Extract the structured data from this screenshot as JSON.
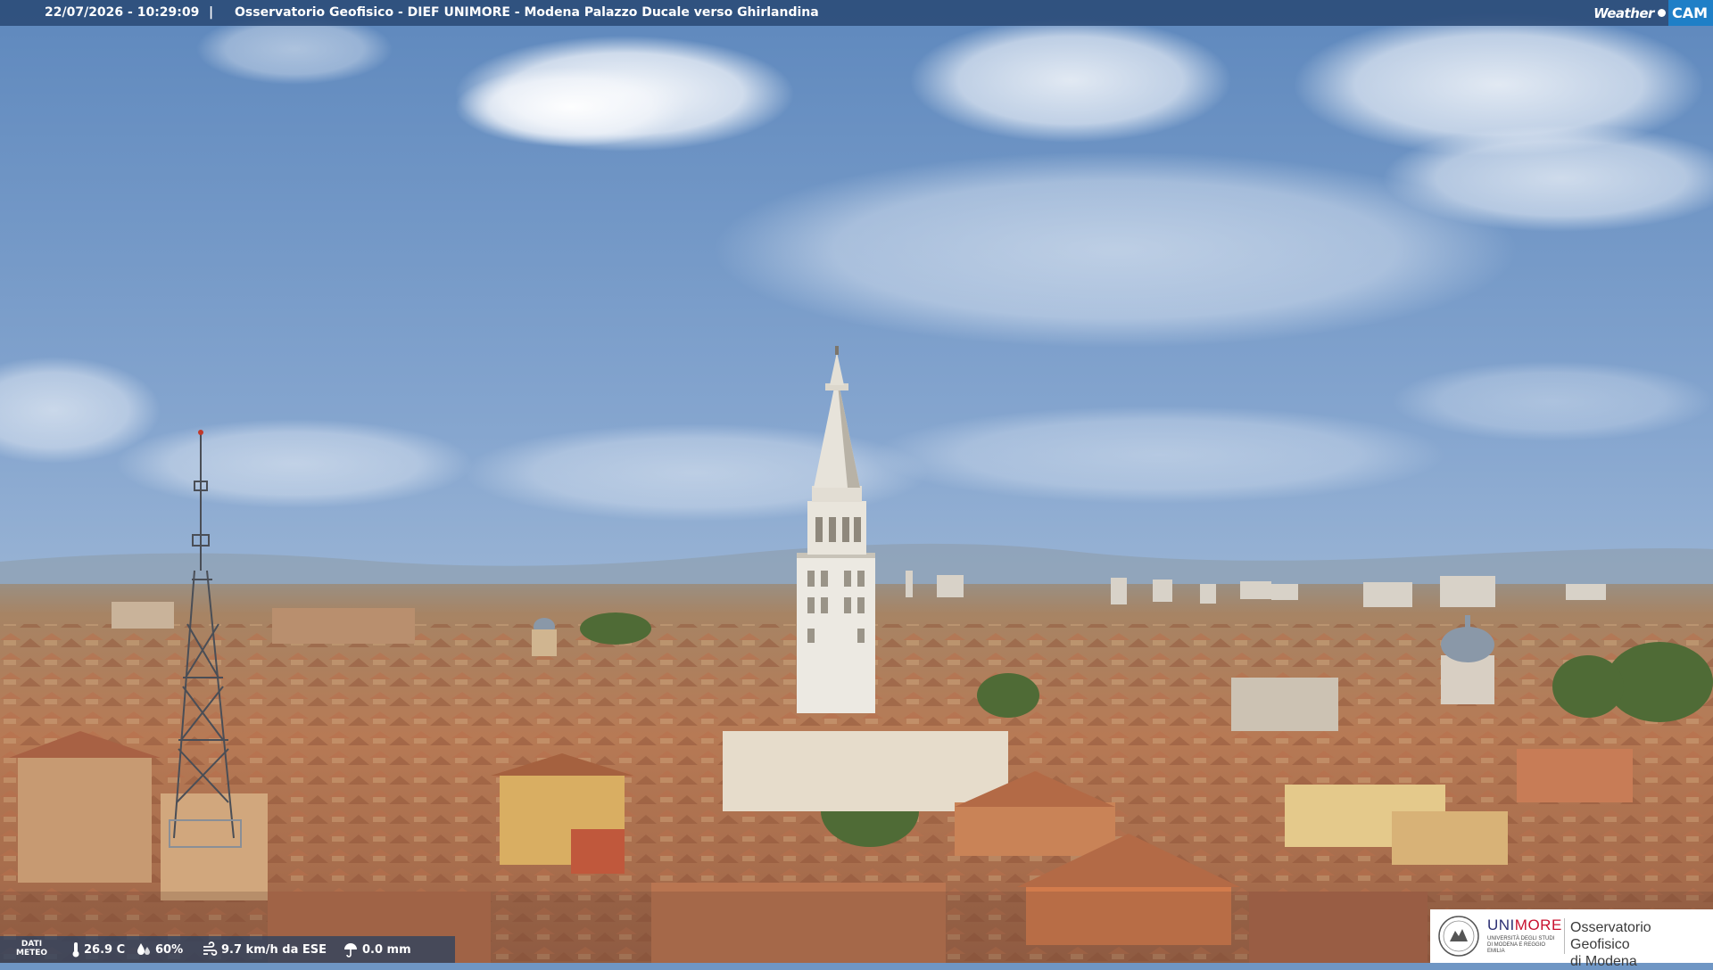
{
  "header": {
    "timestamp": "22/07/2026 - 10:29:09",
    "separator": "|",
    "title": "Osservatorio Geofisico - DIEF UNIMORE - Modena Palazzo Ducale verso Ghirlandina"
  },
  "brand": {
    "weather_text": "Weather",
    "cam_text": "CAM",
    "cam_color": "#1f7fc7"
  },
  "weather_bar": {
    "label_line1": "DATI",
    "label_line2": "METEO",
    "temperature": "26.9 C",
    "humidity": "60%",
    "wind": "9.7 km/h da ESE",
    "rain": "0.0 mm"
  },
  "logo": {
    "uni_blue": "UNI",
    "uni_red": "MORE",
    "subtitle": "UNIVERSITÀ DEGLI STUDI DI MODENA E REGGIO EMILIA",
    "observatory_line1": "Osservatorio Geofisico",
    "observatory_line2": "di Modena"
  }
}
